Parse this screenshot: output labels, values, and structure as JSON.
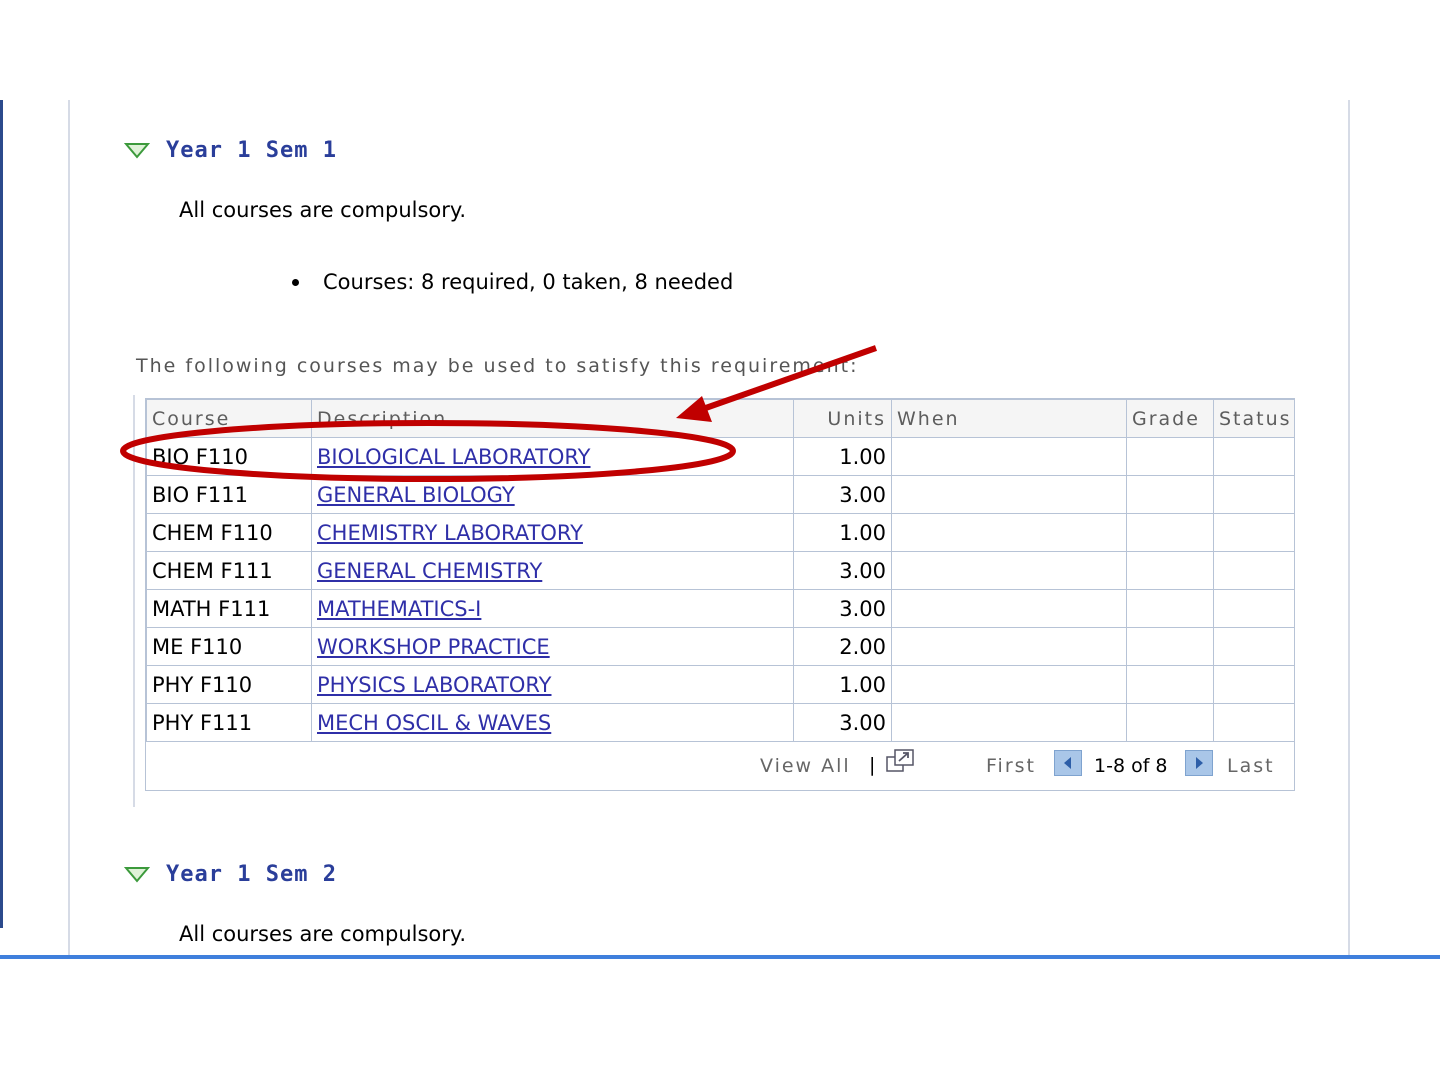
{
  "section1": {
    "title": "Year 1 Sem 1",
    "note": "All courses are compulsory.",
    "summary": "Courses: 8 required, 0 taken, 8 needed",
    "intro": "The following courses may be used to satisfy this requirement:",
    "table": {
      "headers": [
        "Course",
        "Description",
        "Units",
        "When",
        "Grade",
        "Status"
      ],
      "rows": [
        {
          "course": "BIO F110",
          "description": "BIOLOGICAL LABORATORY",
          "units": "1.00",
          "when": "",
          "grade": "",
          "status": ""
        },
        {
          "course": "BIO F111",
          "description": "GENERAL BIOLOGY",
          "units": "3.00",
          "when": "",
          "grade": "",
          "status": ""
        },
        {
          "course": "CHEM F110",
          "description": "CHEMISTRY LABORATORY",
          "units": "1.00",
          "when": "",
          "grade": "",
          "status": ""
        },
        {
          "course": "CHEM F111",
          "description": "GENERAL CHEMISTRY",
          "units": "3.00",
          "when": "",
          "grade": "",
          "status": ""
        },
        {
          "course": "MATH F111",
          "description": "MATHEMATICS-I",
          "units": "3.00",
          "when": "",
          "grade": "",
          "status": ""
        },
        {
          "course": "ME F110",
          "description": "WORKSHOP PRACTICE",
          "units": "2.00",
          "when": "",
          "grade": "",
          "status": ""
        },
        {
          "course": "PHY F110",
          "description": "PHYSICS LABORATORY",
          "units": "1.00",
          "when": "",
          "grade": "",
          "status": ""
        },
        {
          "course": "PHY F111",
          "description": "MECH OSCIL & WAVES",
          "units": "3.00",
          "when": "",
          "grade": "",
          "status": ""
        }
      ]
    },
    "footer": {
      "view_all": "View All",
      "separator": "|",
      "first": "First",
      "range": "1-8 of 8",
      "last": "Last"
    }
  },
  "section2": {
    "title": "Year 1 Sem 2",
    "note": "All courses are compulsory."
  },
  "colors": {
    "heading": "#2a3e9a",
    "link": "#2f2fa8",
    "annotation": "#c00000",
    "triangle": "#3c9a3c"
  },
  "annotation": {
    "highlighted_row": "BIO F110"
  }
}
